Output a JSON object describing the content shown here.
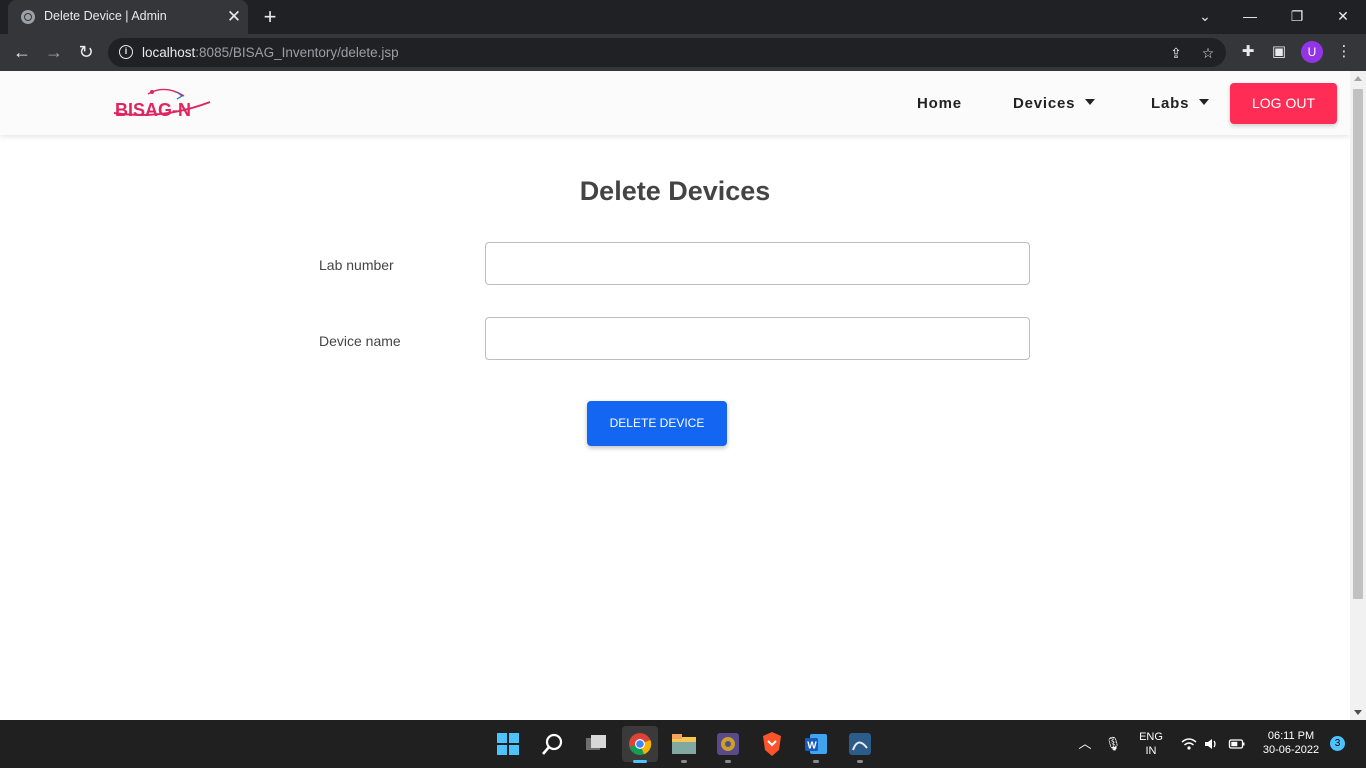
{
  "browser": {
    "tab_title": "Delete Device | Admin",
    "url_host": "localhost",
    "url_rest": ":8085/BISAG_Inventory/delete.jsp",
    "profile_initial": "U"
  },
  "site": {
    "logo_text": "BISAG-N",
    "nav": {
      "home": "Home",
      "devices": "Devices",
      "labs": "Labs",
      "logout": "LOG OUT"
    }
  },
  "form": {
    "title": "Delete Devices",
    "lab_label": "Lab number",
    "lab_value": "",
    "device_label": "Device name",
    "device_value": "",
    "submit_label": "DELETE DEVICE"
  },
  "taskbar": {
    "lang_1": "ENG",
    "lang_2": "IN",
    "time": "06:11 PM",
    "date": "30-06-2022",
    "notifications": "3"
  },
  "colors": {
    "logout": "#ff2d55",
    "primary_button": "#1266f1",
    "logo_pink": "#e0245e",
    "logo_blue": "#1f6fd1"
  }
}
